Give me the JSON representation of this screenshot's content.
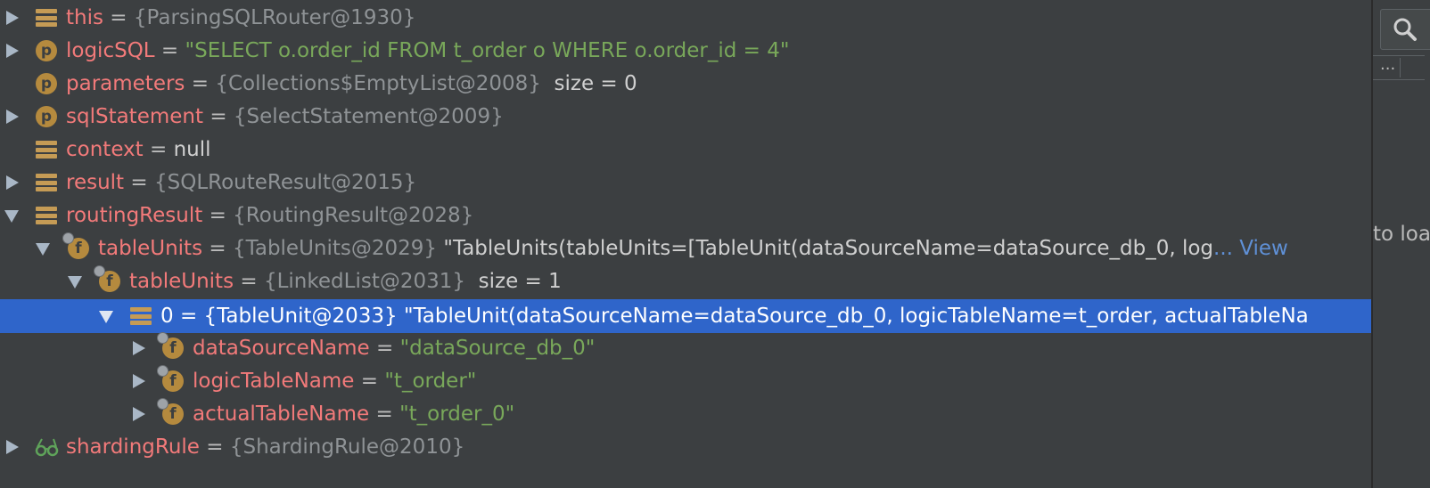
{
  "rows": [
    {
      "name": "this",
      "eq": " = ",
      "ref": "{ParsingSQLRouter@1930}"
    },
    {
      "name": "logicSQL",
      "eq": " = ",
      "str": "\"SELECT o.order_id FROM t_order o WHERE o.order_id = 4\""
    },
    {
      "name": "parameters",
      "eq": " = ",
      "ref": "{Collections$EmptyList@2008}",
      "val": "  size = 0"
    },
    {
      "name": "sqlStatement",
      "eq": " = ",
      "ref": "{SelectStatement@2009}"
    },
    {
      "name": "context",
      "eq": " = ",
      "val": "null"
    },
    {
      "name": "result",
      "eq": " = ",
      "ref": "{SQLRouteResult@2015}"
    },
    {
      "name": "routingResult",
      "eq": " = ",
      "ref": "{RoutingResult@2028}"
    },
    {
      "name": "tableUnits",
      "eq": " = ",
      "ref": "{TableUnits@2029}",
      "val": " \"TableUnits(tableUnits=[TableUnit(dataSourceName=dataSource_db_0, log",
      "link": "... View"
    },
    {
      "name": "tableUnits",
      "eq": " = ",
      "ref": "{LinkedList@2031}",
      "val": "  size = 1"
    },
    {
      "name": "0",
      "eq": " = ",
      "ref": "{TableUnit@2033}",
      "val": " \"TableUnit(dataSourceName=dataSource_db_0, logicTableName=t_order, actualTableNa"
    },
    {
      "name": "dataSourceName",
      "eq": " = ",
      "str": "\"dataSource_db_0\""
    },
    {
      "name": "logicTableName",
      "eq": " = ",
      "str": "\"t_order\""
    },
    {
      "name": "actualTableName",
      "eq": " = ",
      "str": "\"t_order_0\""
    },
    {
      "name": "shardingRule",
      "eq": " = ",
      "ref": "{ShardingRule@2010}"
    }
  ],
  "sidebar": {
    "more_label": "...",
    "partial_text": "to loa"
  },
  "icons": {
    "p_letter": "p",
    "f_letter": "f"
  },
  "colors": {
    "background": "#3c3f41",
    "selection": "#2f65ca",
    "name": "#f27a7a",
    "string": "#79a85a",
    "reference": "#8f9396",
    "link": "#5f90d6"
  }
}
